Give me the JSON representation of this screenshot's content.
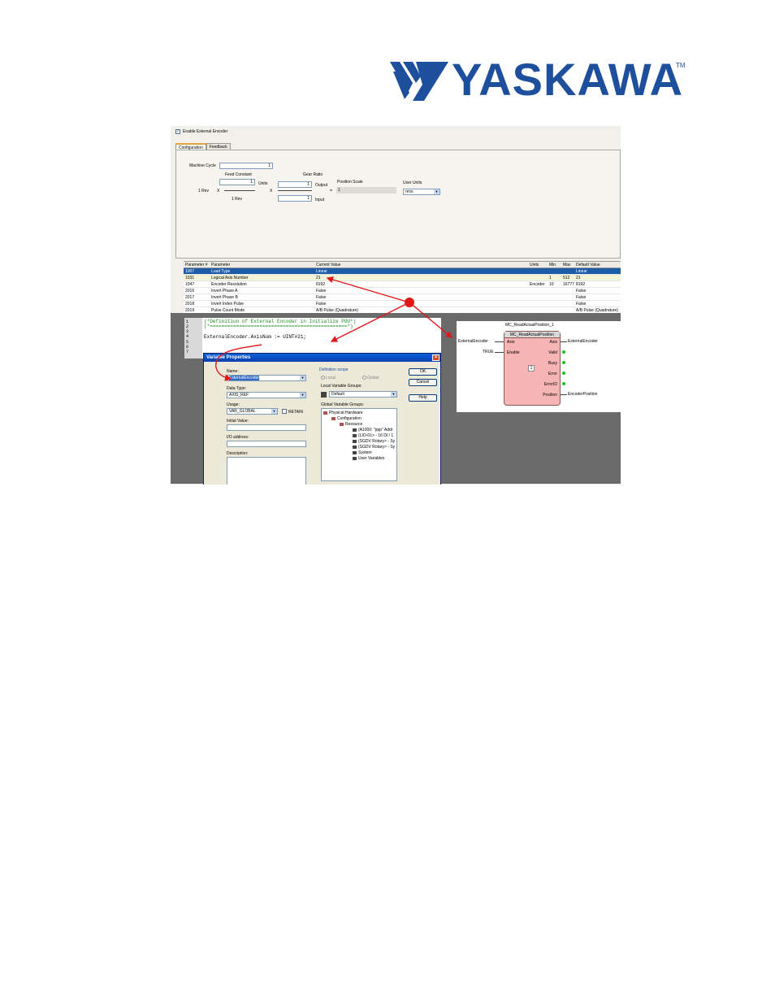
{
  "logo": {
    "text": "YASKAWA",
    "tm": "TM",
    "color": "#1e4f9c"
  },
  "config": {
    "enable_label": "Enable External Encoder",
    "tabs": [
      "Configuration",
      "Feedback"
    ],
    "machine_cycle_label": "Machine Cycle",
    "machine_cycle_value": "1",
    "feed_constant_label": "Feed Constant",
    "feed_constant_value": "1",
    "units_label": "Units",
    "gear_ratio_label": "Gear Ratio",
    "gear_output_value": "1",
    "output_label": "Output",
    "gear_input_value": "1",
    "input_label": "Input",
    "one_rev_left": "1 Rev",
    "x_label": "X",
    "one_rev_bottom": "1 Rev",
    "position_scale_label": "Position Scale",
    "equals": "=",
    "position_scale_value": "1",
    "user_units_label": "User Units",
    "user_units_value": "revs"
  },
  "param_table": {
    "headers": [
      "Parameter #",
      "Parameter",
      "Current Value",
      "Units",
      "Min",
      "Max",
      "Default Value"
    ],
    "rows": [
      [
        "1007",
        "Load Type",
        "Linear",
        "",
        "",
        "",
        "Linear"
      ],
      [
        "1031",
        "Logical Axis Number",
        "21",
        "",
        "1",
        "512",
        "21"
      ],
      [
        "1047",
        "Encoder Resolution",
        "8192",
        "Encoder",
        "10",
        "16777",
        "8192"
      ],
      [
        "2016",
        "Invert Phase A",
        "False",
        "",
        "",
        "",
        "False"
      ],
      [
        "2017",
        "Invert Phase B",
        "False",
        "",
        "",
        "",
        "False"
      ],
      [
        "2018",
        "Invert Index Pulse",
        "False",
        "",
        "",
        "",
        "False"
      ],
      [
        "2019",
        "Pulse Count Mode",
        "A/B Pulse (Quadrature)",
        "",
        "",
        "",
        "A/B Pulse (Quadrature)"
      ]
    ]
  },
  "editor": {
    "line_numbers": [
      "1",
      "2",
      "3",
      "4",
      "5",
      "6",
      "7"
    ],
    "line1": "(*Definition of External Encoder in Initialize POU*)",
    "line2": "(*===============================================*)",
    "line4": "ExternalEncoder.AxisNum := UINT#21;"
  },
  "function_block": {
    "instance": "MC_ReadActualPosition_1",
    "type": "MC_ReadActualPosition",
    "in_axis_var": "ExternalEncoder",
    "in_enable_var": "TRUE",
    "pin_axis_in": "Axis",
    "pin_enable": "Enable",
    "pin_axis_out": "Axis",
    "pin_valid": "Valid",
    "pin_busy": "Busy",
    "pin_error": "Error",
    "pin_errorid": "ErrorID",
    "pin_position": "Position",
    "out_axis_var": "ExternalEncoder",
    "out_position_var": "EncoderPosition",
    "exec_order": "1"
  },
  "dialog": {
    "title": "Variable Properties",
    "name_label": "Name:",
    "name_value": "ExternalEncoder",
    "data_type_label": "Data Type:",
    "data_type_value": "AXIS_REF",
    "usage_label": "Usage:",
    "usage_value": "VAR_GLOBAL",
    "retain_label": "RETAIN",
    "initial_value_label": "Initial Value:",
    "io_address_label": "I/O address:",
    "description_label": "Description:",
    "definition_scope_label": "Definition scope",
    "local_label": "Local",
    "global_label": "Global",
    "local_groups_label": "Local Variable Groups:",
    "local_groups_value": "Default",
    "global_groups_label": "Global Variable Groups:",
    "tree": [
      "Physical Hardware",
      "Configuration",
      "Resource",
      "(A1000: \"ppp\" Addr",
      "(LIO-01> - 16 DI / 1",
      "(SGDV Rotary> - Sy",
      "(SGDV Rotary> - Sy",
      "System",
      "User Variables"
    ],
    "ok_label": "OK",
    "cancel_label": "Cancel",
    "help_label": "Help"
  }
}
